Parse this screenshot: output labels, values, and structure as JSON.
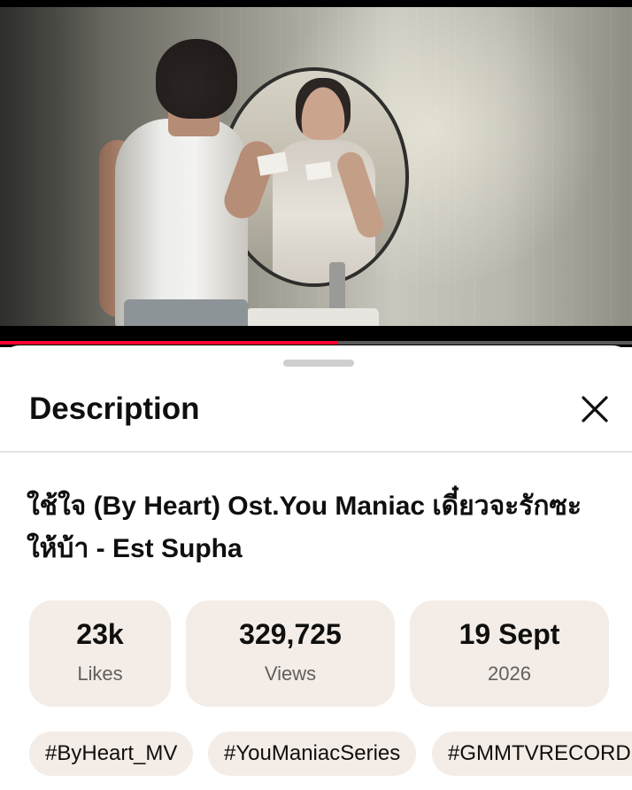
{
  "player": {
    "progress": 0.535
  },
  "sheet": {
    "heading": "Description",
    "close_icon": "close-icon"
  },
  "video": {
    "title": "ใช้ใจ (By Heart) Ost.You Maniac เดี๋ยวจะรักซะให้บ้า - Est Supha"
  },
  "stats": [
    {
      "value": "23k",
      "label": "Likes"
    },
    {
      "value": "329,725",
      "label": "Views"
    },
    {
      "value": "19 Sept",
      "label": "2026"
    }
  ],
  "tags": [
    "#ByHeart_MV",
    "#YouManiacSeries",
    "#GMMTVRECORDS"
  ],
  "colors": {
    "progress": "#ff0033",
    "chip_background": "#f4ece6",
    "secondary_text": "#606060"
  }
}
